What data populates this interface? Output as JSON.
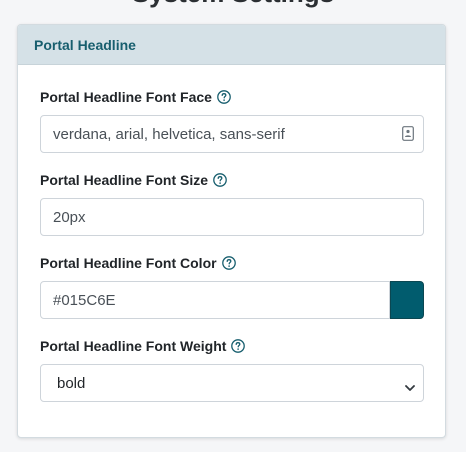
{
  "page": {
    "title": "System Settings"
  },
  "section": {
    "title": "Portal Headline"
  },
  "fields": {
    "font_face": {
      "label": "Portal Headline Font Face",
      "value": "verdana, arial, helvetica, sans-serif"
    },
    "font_size": {
      "label": "Portal Headline Font Size",
      "value": "20px"
    },
    "font_color": {
      "label": "Portal Headline Font Color",
      "value": "#015C6E",
      "swatch_color": "#015C6E"
    },
    "font_weight": {
      "label": "Portal Headline Font Weight",
      "selected": "bold"
    }
  },
  "icons": {
    "help": "question-circle-icon",
    "autofill": "contact-card-icon",
    "dropdown": "chevron-down-icon"
  },
  "colors": {
    "accent": "#175E6E",
    "header_bg": "#D5E1E7"
  }
}
